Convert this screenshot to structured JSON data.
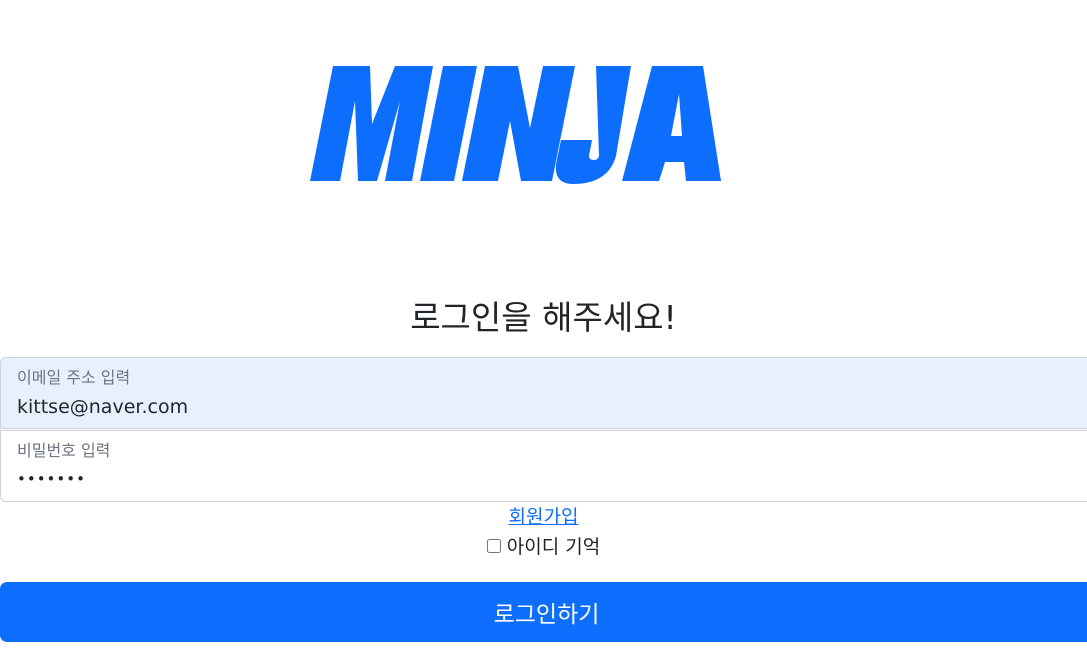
{
  "logo": {
    "text": "MINJA",
    "color": "#0d6efd"
  },
  "title": "로그인을 해주세요!",
  "email": {
    "label": "이메일 주소 입력",
    "value": "kittse@naver.com"
  },
  "password": {
    "label": "비밀번호 입력",
    "value": "•••••••"
  },
  "signup_link": "회원가입",
  "remember": {
    "label": "아이디 기억",
    "checked": false
  },
  "login_button": "로그인하기",
  "colors": {
    "primary": "#0d6efd",
    "autofill_bg": "#e8f0fe",
    "border": "#ced4da",
    "text": "#212529",
    "muted": "#6c757d"
  }
}
